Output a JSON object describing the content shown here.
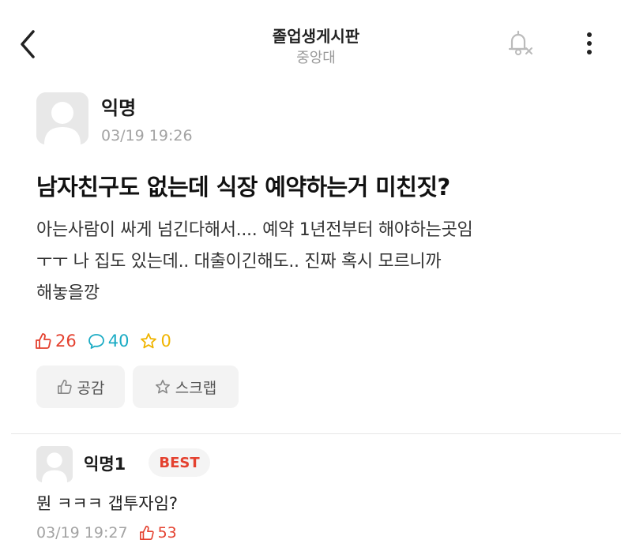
{
  "header": {
    "title": "졸업생게시판",
    "subtitle": "중앙대"
  },
  "post": {
    "author": "익명",
    "timestamp": "03/19 19:26",
    "title": "남자친구도 없는데 식장 예약하는거 미친짓?",
    "body_lines": [
      "아는사람이 싸게 넘긴다해서.... 예약 1년전부터 해야하는곳임",
      "ㅜㅜ 나 집도 있는데.. 대출이긴해도.. 진짜 혹시 모르니까",
      "해놓을깡"
    ],
    "likes": "26",
    "comments": "40",
    "scraps": "0"
  },
  "actions": {
    "like_label": "공감",
    "scrap_label": "스크랩"
  },
  "best_comment": {
    "author": "익명1",
    "badge": "BEST",
    "text": "뭔 ㅋㅋㅋ 갭투자임?",
    "timestamp": "03/19 19:27",
    "likes": "53"
  },
  "colors": {
    "like": "#e4412f",
    "comment": "#1aabc4",
    "scrap": "#f0b400",
    "muted": "#a3a3a3"
  },
  "icons": {
    "back": "chevron-left-icon",
    "bell": "bell-off-icon",
    "more": "more-vertical-icon",
    "like": "thumbs-up-icon",
    "comment": "speech-bubble-icon",
    "scrap": "star-icon"
  }
}
